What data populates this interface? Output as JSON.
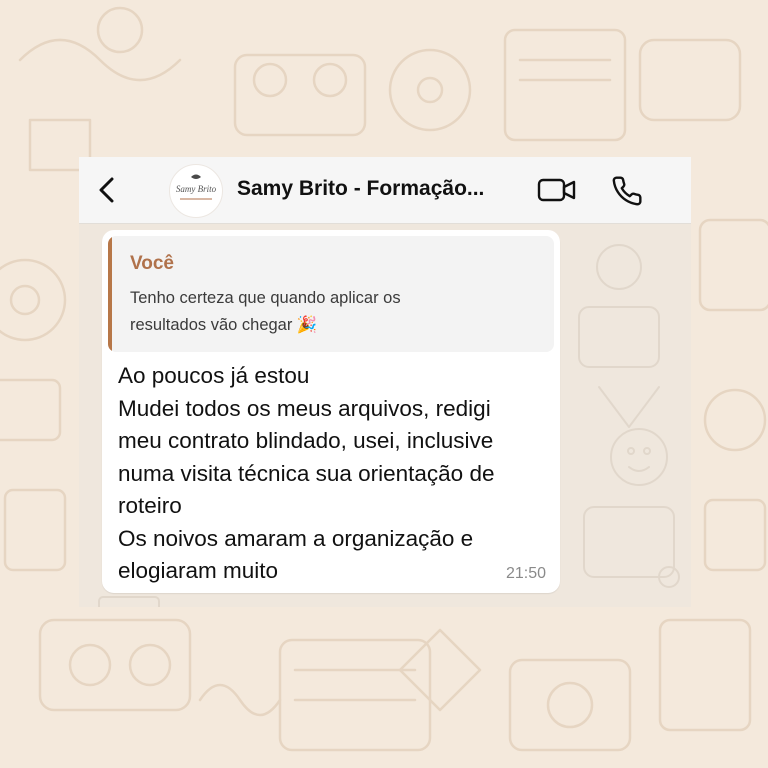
{
  "colors": {
    "page_background": "#f4e9dc",
    "chat_background": "#efe7dd",
    "header_background": "#f6f6f6",
    "quote_accent": "#b77748",
    "quote_author": "#b0724b"
  },
  "header": {
    "back_icon": "chevron-left-icon",
    "avatar_text": "Samy Brito",
    "title": "Samy Brito - Formação...",
    "video_icon": "video-camera-icon",
    "phone_icon": "phone-icon"
  },
  "message": {
    "quote": {
      "author": "Você",
      "lines": [
        "Tenho certeza que quando aplicar os",
        "resultados vão chegar 🎉"
      ]
    },
    "lines": [
      "Ao poucos já estou",
      "Mudei todos os meus arquivos, redigi",
      "meu contrato blindado, usei, inclusive",
      "numa visita técnica sua orientação de",
      "roteiro",
      "Os noivos amaram a organização e",
      "elogiaram muito"
    ],
    "time": "21:50"
  }
}
